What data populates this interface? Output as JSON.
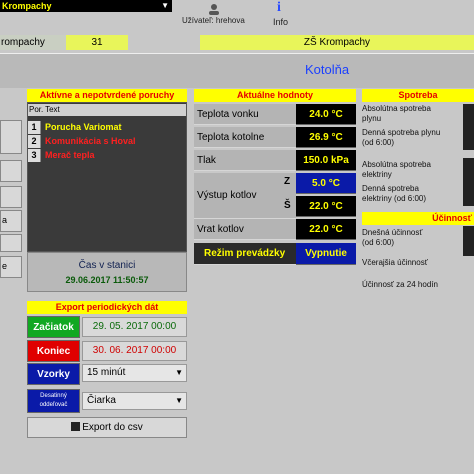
{
  "topbar": {
    "location_select": "Krompachy",
    "user_label": "Užívateľ: hrehova",
    "info_label": "Info"
  },
  "status_bar": {
    "left": "rompachy",
    "number": "31",
    "school": "ZŠ Krompachy"
  },
  "page_title": "Kotolňa",
  "nav": [
    "",
    "",
    "",
    "a",
    "",
    "e"
  ],
  "faults": {
    "title": "Aktívne a nepotvrdené poruchy",
    "col_index": "Por.",
    "col_text": "Text",
    "rows": [
      {
        "index": "1",
        "text": "Porucha Variomat",
        "color": "#ffff00"
      },
      {
        "index": "2",
        "text": "Komunikácia s Hoval",
        "color": "#ff2020"
      },
      {
        "index": "3",
        "text": "Merač tepla",
        "color": "#ff2020"
      }
    ]
  },
  "station_time": {
    "label": "Čas v stanici",
    "value": "29.06.2017 11:50:57"
  },
  "export": {
    "title": "Export periodických dát",
    "start_label": "Začiatok",
    "start_value": "29. 05. 2017 00:00",
    "end_label": "Koniec",
    "end_value": "30. 06. 2017 00:00",
    "samples_label": "Vzorky",
    "samples_value": "15 minút",
    "decimal_label_1": "Desatinný",
    "decimal_label_2": "oddeľovač",
    "decimal_value": "Čiarka",
    "button_label": "Export do csv"
  },
  "current": {
    "title": "Aktuálne hodnoty",
    "outdoor_label": "Teplota vonku",
    "outdoor_value": "24.0 °C",
    "boiler_label": "Teplota kotolne",
    "boiler_value": "26.9 °C",
    "pressure_label": "Tlak",
    "pressure_value": "150.0 kPa",
    "output_label": "Výstup kotlov",
    "output_z_tag": "Z",
    "output_z_value": "5.0 °C",
    "output_s_tag": "Š",
    "output_s_value": "22.0 °C",
    "return_label": "Vrat kotlov",
    "return_value": "22.0 °C",
    "mode_label": "Režim prevádzky",
    "mode_value": "Vypnutie"
  },
  "consumption": {
    "title": "Spotreba",
    "gas_abs_1": "Absolútna spotreba",
    "gas_abs_2": "plynu",
    "gas_day_1": "Denná spotreba plynu",
    "gas_day_2": "(od 6:00)",
    "el_abs_1": "Absolútna spotreba",
    "el_abs_2": "elektriny",
    "el_day_1": "Denná spotreba",
    "el_day_2": "elektriny (od 6:00)"
  },
  "efficiency": {
    "title": "Účinnosť",
    "today_1": "Dnešná účinnosť",
    "today_2": "(od 6:00)",
    "yesterday": "Včerajšia účinnosť",
    "last24": "Účinnosť za 24 hodín"
  }
}
